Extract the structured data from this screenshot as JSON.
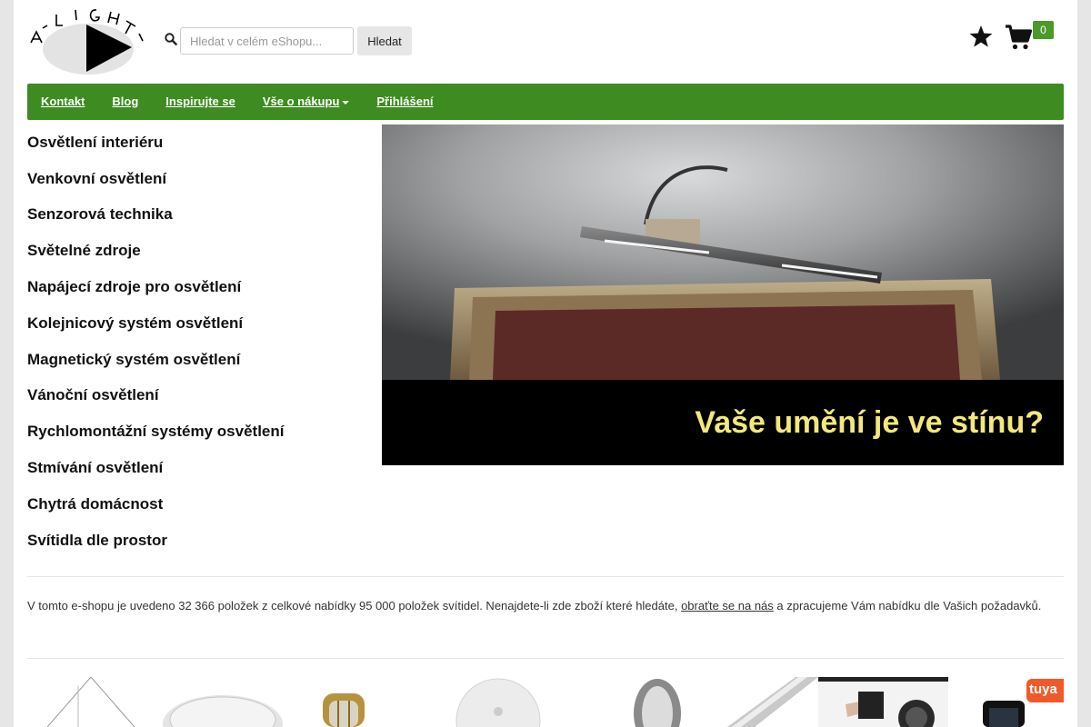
{
  "header": {
    "logo_letters": "A LIGHT",
    "search": {
      "placeholder": "Hledat v celém eShopu...",
      "button_label": "Hledat"
    },
    "cart_count": "0"
  },
  "nav": {
    "items": [
      {
        "label": "Kontakt"
      },
      {
        "label": "Blog"
      },
      {
        "label": "Inspirujte se"
      },
      {
        "label": "Vše o nákupu",
        "dropdown": true
      },
      {
        "label": "Přihlášení"
      }
    ]
  },
  "categories": [
    "Osvětlení interiéru",
    "Venkovní osvětlení",
    "Senzorová technika",
    "Světelné zdroje",
    "Napájecí zdroje pro osvětlení",
    "Kolejnicový systém osvětlení",
    "Magnetický systém osvětlení",
    "Vánoční osvětlení",
    "Rychlomontážní systémy osvětlení",
    "Stmívání osvětlení",
    "Chytrá domácnost",
    "Svítidla dle prostor"
  ],
  "banner": {
    "caption": "Vaše umění je ve stínu?"
  },
  "info": {
    "text_before": "V tomto e-shopu je uvedeno 32 366 položek z celkové nabídky 95 000 položek svítidel. Nenajdete-li zde zboží které hledáte, ",
    "link_text": "obraťte se na nás",
    "text_after": " a zpracujeme Vám nabídku dle Vašich požadavků."
  },
  "thumbnails": {
    "tuya_label": "tuya"
  },
  "colors": {
    "nav_green": "#3d8b21",
    "cart_badge": "#4a9a2a",
    "banner_caption": "#f3e87c"
  }
}
